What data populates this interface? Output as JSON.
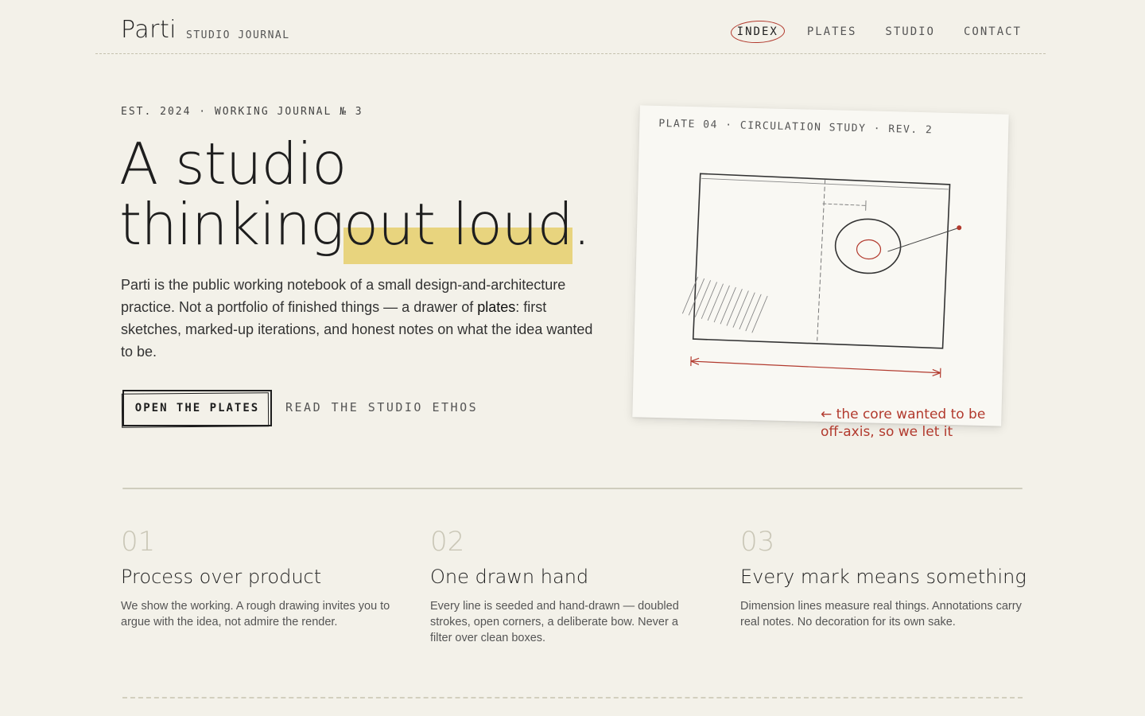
{
  "header": {
    "logo": "Parti",
    "logo_sub": "STUDIO JOURNAL",
    "nav": [
      {
        "label": "INDEX",
        "active": true
      },
      {
        "label": "PLATES",
        "active": false
      },
      {
        "label": "STUDIO",
        "active": false
      },
      {
        "label": "CONTACT",
        "active": false
      }
    ]
  },
  "hero": {
    "eyebrow": "EST. 2024 · WORKING JOURNAL № 3",
    "title_line1": "A studio",
    "title_line2_a": "thinking",
    "title_line2_hl": " out loud",
    "title_line2_end": ".",
    "lede_a": "Parti is the public working notebook of a small design-and-architecture practice. Not a portfolio of finished things — a drawer of ",
    "lede_em": "plates",
    "lede_b": ": first sketches, marked-up iterations, and honest notes on what the idea wanted to be.",
    "primary_cta": "OPEN THE PLATES",
    "secondary_cta": "READ THE STUDIO ETHOS"
  },
  "plate": {
    "label": "PLATE 04 · CIRCULATION STUDY · REV. 2",
    "annotation": "← the core wanted to be off-axis, so we let it",
    "accent_color": "#b23a2e"
  },
  "features": [
    {
      "num": "01",
      "title": "Process over product",
      "body": "We show the working. A rough drawing invites you to argue with the idea, not admire the render."
    },
    {
      "num": "02",
      "title": "One drawn hand",
      "body": "Every line is seeded and hand-drawn — doubled strokes, open corners, a deliberate bow. Never a filter over clean boxes."
    },
    {
      "num": "03",
      "title": "Every mark means something",
      "body": "Dimension lines measure real things. Annotations carry real notes. No decoration for its own sake."
    }
  ]
}
